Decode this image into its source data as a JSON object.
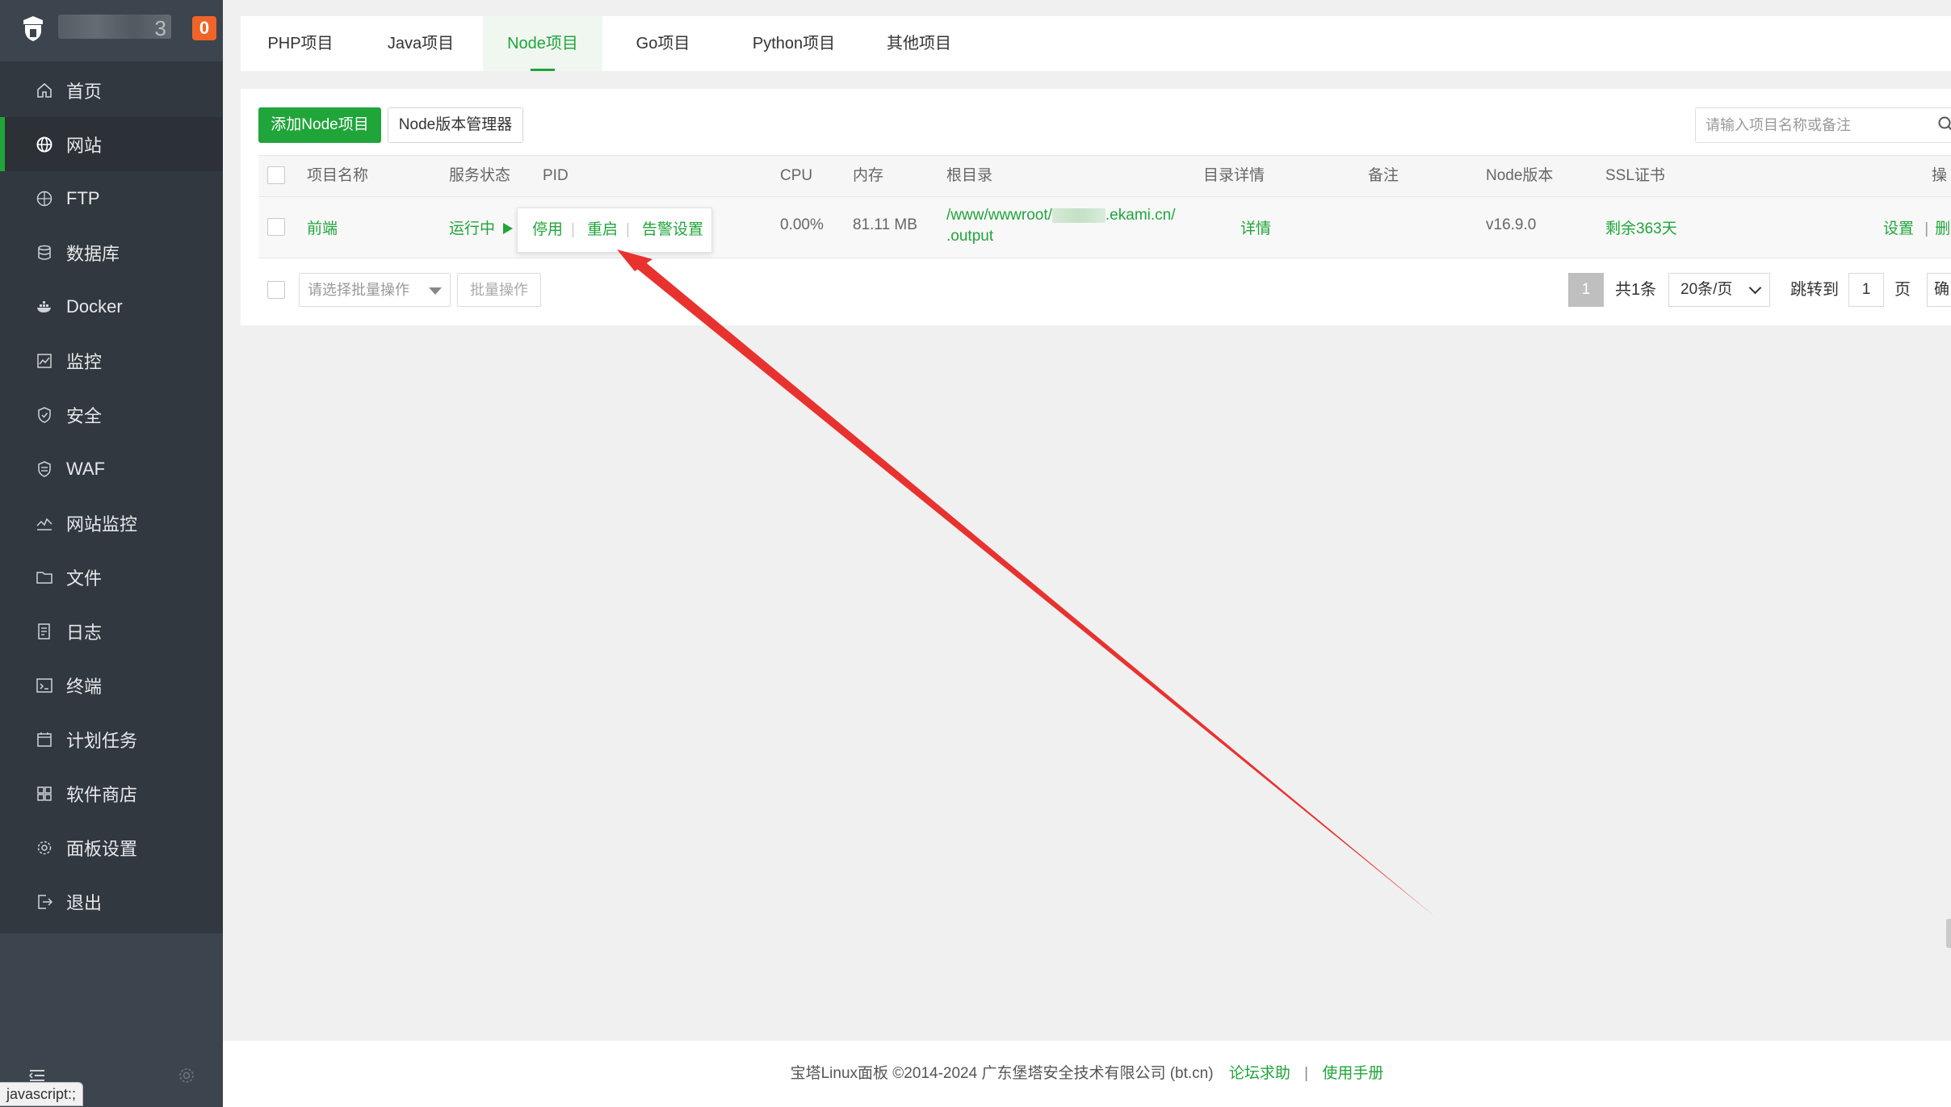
{
  "sidebar": {
    "server_name": "3",
    "badge": "0",
    "items": [
      {
        "label": "首页",
        "icon": "home-icon"
      },
      {
        "label": "网站",
        "icon": "globe-icon"
      },
      {
        "label": "FTP",
        "icon": "ftp-globe-icon"
      },
      {
        "label": "数据库",
        "icon": "database-icon"
      },
      {
        "label": "Docker",
        "icon": "docker-icon"
      },
      {
        "label": "监控",
        "icon": "monitor-icon"
      },
      {
        "label": "安全",
        "icon": "shield-icon"
      },
      {
        "label": "WAF",
        "icon": "waf-shield-icon"
      },
      {
        "label": "网站监控",
        "icon": "chart-line-icon"
      },
      {
        "label": "文件",
        "icon": "folder-icon"
      },
      {
        "label": "日志",
        "icon": "log-icon"
      },
      {
        "label": "终端",
        "icon": "terminal-icon"
      },
      {
        "label": "计划任务",
        "icon": "calendar-icon"
      },
      {
        "label": "软件商店",
        "icon": "grid-icon"
      },
      {
        "label": "面板设置",
        "icon": "gear-icon"
      },
      {
        "label": "退出",
        "icon": "logout-icon"
      }
    ],
    "active_index": 1
  },
  "status_url": "javascript:;",
  "tabs": [
    "PHP项目",
    "Java项目",
    "Node项目",
    "Go项目",
    "Python项目",
    "其他项目"
  ],
  "active_tab": "Node项目",
  "toolbar": {
    "add_button": "添加Node项目",
    "version_manager": "Node版本管理器",
    "search_placeholder": "请输入项目名称或备注"
  },
  "table": {
    "headers": [
      "项目名称",
      "服务状态",
      "PID",
      "CPU",
      "内存",
      "根目录",
      "目录详情",
      "备注",
      "Node版本",
      "SSL证书",
      "操"
    ],
    "rows": [
      {
        "name": "前端",
        "status": "运行中",
        "cpu": "0.00%",
        "memory": "81.11 MB",
        "root_prefix": "/www/wwwroot/",
        "root_suffix": ".ekami.cn/",
        "root_line2": ".output",
        "detail": "详情",
        "remark": "",
        "node_version": "v16.9.0",
        "ssl": "剩余363天",
        "action_settings": "设置",
        "action_delete": "删"
      }
    ]
  },
  "popup": {
    "stop": "停用",
    "restart": "重启",
    "alert": "告警设置"
  },
  "batch": {
    "select_placeholder": "请选择批量操作",
    "button": "批量操作"
  },
  "pagination": {
    "current": "1",
    "total": "共1条",
    "page_size": "20条/页",
    "jump_label": "跳转到",
    "jump_value": "1",
    "page_unit": "页",
    "confirm": "确"
  },
  "footer": {
    "copyright": "宝塔Linux面板 ©2014-2024 广东堡塔安全技术有限公司 (bt.cn)",
    "forum": "论坛求助",
    "manual": "使用手册"
  },
  "colors": {
    "accent": "#20a53a",
    "sidebar_bg": "#3c444d",
    "menu_bg": "#31383f",
    "badge": "#f0642a",
    "annotation_arrow": "#e8322f"
  }
}
